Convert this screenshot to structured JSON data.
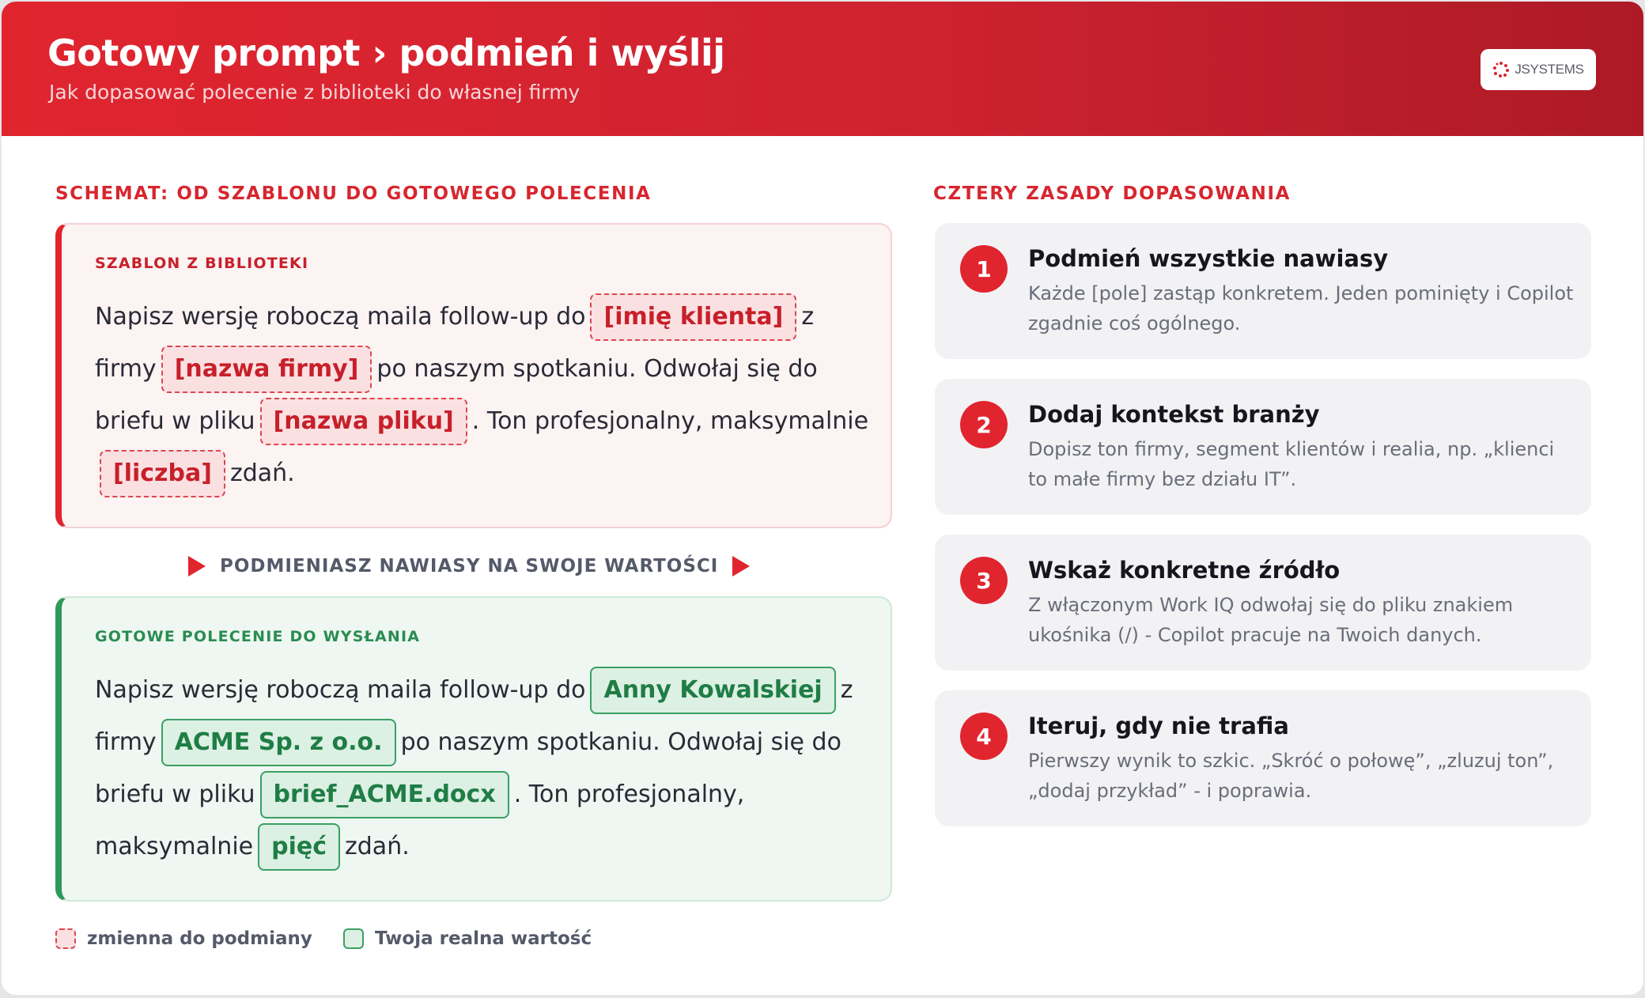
{
  "header": {
    "title": "Gotowy prompt › podmień i wyślij",
    "subtitle": "Jak dopasować polecenie z biblioteki do własnej firmy",
    "logo_text": "JSYSTEMS"
  },
  "left": {
    "heading": "SCHEMAT: OD SZABLONU DO GOTOWEGO POLECENIA",
    "template": {
      "label": "SZABLON Z BIBLIOTEKI",
      "t1": "Napisz wersję roboczą maila follow-up do",
      "v1": "[imię klienta]",
      "t2": "z firmy",
      "v2": "[nazwa firmy]",
      "t3": "po naszym spotkaniu. Odwołaj się do briefu w pliku",
      "v3": "[nazwa pliku]",
      "t4": ". Ton profesjonalny, maksymalnie",
      "v4": "[liczba]",
      "t5": "zdań."
    },
    "arrow_text": "PODMIENIASZ NAWIASY NA SWOJE WARTOŚCI",
    "ready": {
      "label": "GOTOWE POLECENIE DO WYSŁANIA",
      "t1": "Napisz wersję roboczą maila follow-up do",
      "v1": "Anny Kowalskiej",
      "t2": "z firmy",
      "v2": "ACME Sp. z o.o.",
      "t3": "po naszym spotkaniu. Odwołaj się do briefu w pliku",
      "v3": "brief_ACME.docx",
      "t4": ". Ton profesjonalny, maksymalnie",
      "v4": "pięć",
      "t5": "zdań."
    },
    "legend": {
      "variable": "zmienna do podmiany",
      "value": "Twoja realna wartość"
    }
  },
  "right": {
    "heading": "CZTERY ZASADY DOPASOWANIA",
    "rules": [
      {
        "num": "1",
        "title": "Podmień wszystkie nawiasy",
        "desc": "Każde [pole] zastąp konkretem. Jeden pominięty i Copilot zgadnie coś ogólnego."
      },
      {
        "num": "2",
        "title": "Dodaj kontekst branży",
        "desc": "Dopisz ton firmy, segment klientów i realia, np. „klienci to małe firmy bez działu IT”."
      },
      {
        "num": "3",
        "title": "Wskaż konkretne źródło",
        "desc": "Z włączonym Work IQ odwołaj się do pliku znakiem ukośnika (/) - Copilot pracuje na Twoich danych."
      },
      {
        "num": "4",
        "title": "Iteruj, gdy nie trafia",
        "desc": "Pierwszy wynik to szkic. „Skróć o połowę”, „zluzuj ton”, „dodaj przykład” - i poprawia."
      }
    ]
  },
  "colors": {
    "accent_red": "#e0252f",
    "accent_green": "#2e9a5a",
    "text_dark": "#16161e",
    "text_muted": "#6a6e7a"
  }
}
